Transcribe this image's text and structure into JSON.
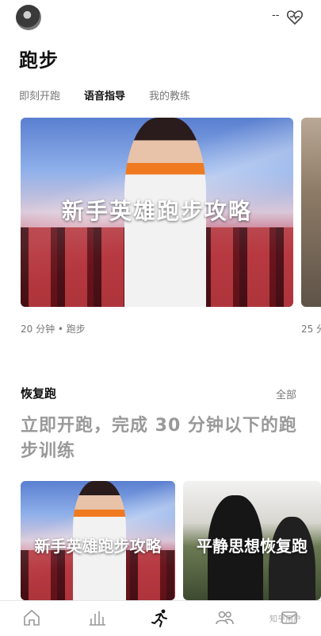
{
  "header": {
    "status_text": "--",
    "heart_icon": "heart-rate-icon"
  },
  "page": {
    "title": "跑步"
  },
  "tabs": [
    {
      "label": "即刻开跑",
      "active": false
    },
    {
      "label": "语音指导",
      "active": true
    },
    {
      "label": "我的教练",
      "active": false
    }
  ],
  "featured": {
    "title": "新手英雄跑步攻略",
    "meta": "20 分钟 • 跑步",
    "peek_meta": "25 分"
  },
  "recovery": {
    "title": "恢复跑",
    "see_all": "全部",
    "description": "立即开跑，完成 30 分钟以下的跑步训练",
    "cards": [
      {
        "title": "新手英雄跑步攻略"
      },
      {
        "title": "平静思想恢复跑"
      }
    ]
  },
  "bottom_nav": {
    "items": [
      "home-icon",
      "activity-icon",
      "run-icon",
      "community-icon",
      "inbox-icon"
    ],
    "active_index": 2,
    "accent": "#111111"
  },
  "watermark": "知乎用户"
}
